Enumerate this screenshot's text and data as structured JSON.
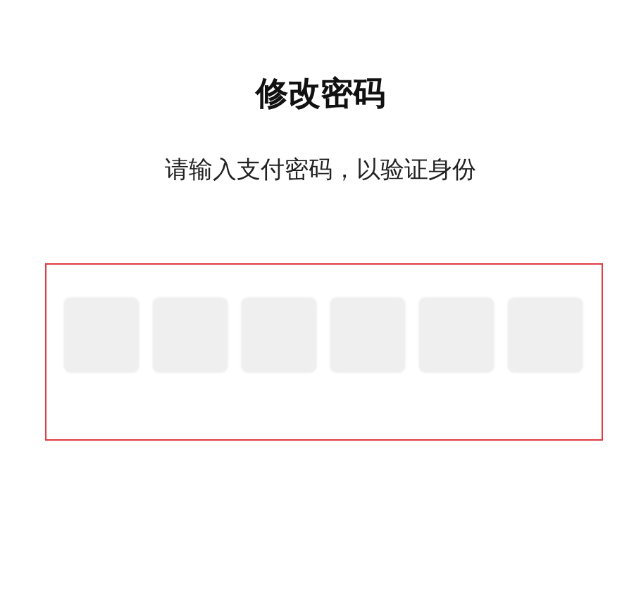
{
  "title": "修改密码",
  "subtitle": "请输入支付密码，以验证身份",
  "highlight_frame": true,
  "pin_boxes": [
    {
      "filled": false
    },
    {
      "filled": false
    },
    {
      "filled": false
    },
    {
      "filled": false
    },
    {
      "filled": false
    },
    {
      "filled": false
    }
  ]
}
